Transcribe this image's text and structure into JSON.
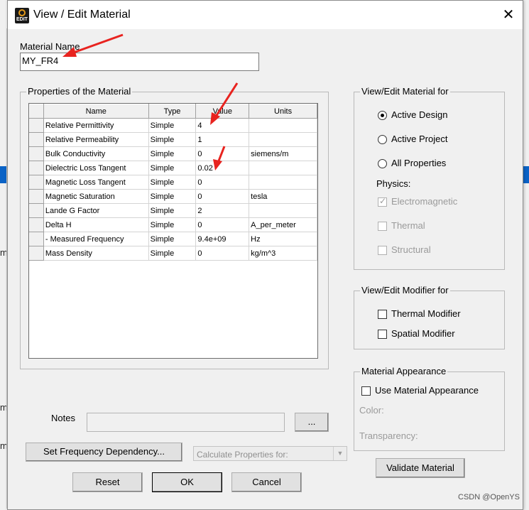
{
  "dialog": {
    "title": "View / Edit Material",
    "icon_label": "EDIT",
    "close_symbol": "✕"
  },
  "background_window": {
    "fragments": [
      "m",
      "m",
      "m",
      "m"
    ]
  },
  "material_name": {
    "label": "Material Name",
    "value": "MY_FR4"
  },
  "properties": {
    "group_label": "Properties of the Material",
    "columns": [
      "Name",
      "Type",
      "Value",
      "Units"
    ],
    "rows": [
      {
        "name": "Relative Permittivity",
        "type": "Simple",
        "value": "4",
        "units": ""
      },
      {
        "name": "Relative Permeability",
        "type": "Simple",
        "value": "1",
        "units": ""
      },
      {
        "name": "Bulk Conductivity",
        "type": "Simple",
        "value": "0",
        "units": "siemens/m"
      },
      {
        "name": "Dielectric Loss Tangent",
        "type": "Simple",
        "value": "0.02",
        "units": ""
      },
      {
        "name": "Magnetic Loss Tangent",
        "type": "Simple",
        "value": "0",
        "units": ""
      },
      {
        "name": "Magnetic Saturation",
        "type": "Simple",
        "value": "0",
        "units": "tesla"
      },
      {
        "name": "Lande G Factor",
        "type": "Simple",
        "value": "2",
        "units": ""
      },
      {
        "name": "Delta H",
        "type": "Simple",
        "value": "0",
        "units": "A_per_meter"
      },
      {
        "name": "-  Measured Frequency",
        "type": "Simple",
        "value": "9.4e+09",
        "units": "Hz"
      },
      {
        "name": "Mass Density",
        "type": "Simple",
        "value": "0",
        "units": "kg/m^3"
      }
    ]
  },
  "view_edit_for": {
    "group_label": "View/Edit Material for",
    "options": [
      "Active Design",
      "Active Project",
      "All Properties"
    ],
    "selected": "Active Design",
    "physics_label": "Physics:",
    "physics": [
      {
        "label": "Electromagnetic",
        "checked": true,
        "enabled": false
      },
      {
        "label": "Thermal",
        "checked": false,
        "enabled": false
      },
      {
        "label": "Structural",
        "checked": false,
        "enabled": false
      }
    ]
  },
  "modifier_for": {
    "group_label": "View/Edit Modifier for",
    "thermal_label": "Thermal Modifier",
    "spatial_label": "Spatial Modifier"
  },
  "appearance": {
    "group_label": "Material Appearance",
    "use_label": "Use Material Appearance",
    "color_label": "Color:",
    "transparency_label": "Transparency:"
  },
  "notes": {
    "label": "Notes",
    "value": "",
    "browse_label": "..."
  },
  "buttons": {
    "set_frequency": "Set Frequency Dependency...",
    "calc_props_placeholder": "Calculate Properties for:",
    "validate": "Validate Material",
    "reset": "Reset",
    "ok": "OK",
    "cancel": "Cancel"
  },
  "watermark": "CSDN @OpenYS",
  "colors": {
    "annotation_arrow": "#e8231f",
    "selection_blue": "#0b63c6"
  }
}
